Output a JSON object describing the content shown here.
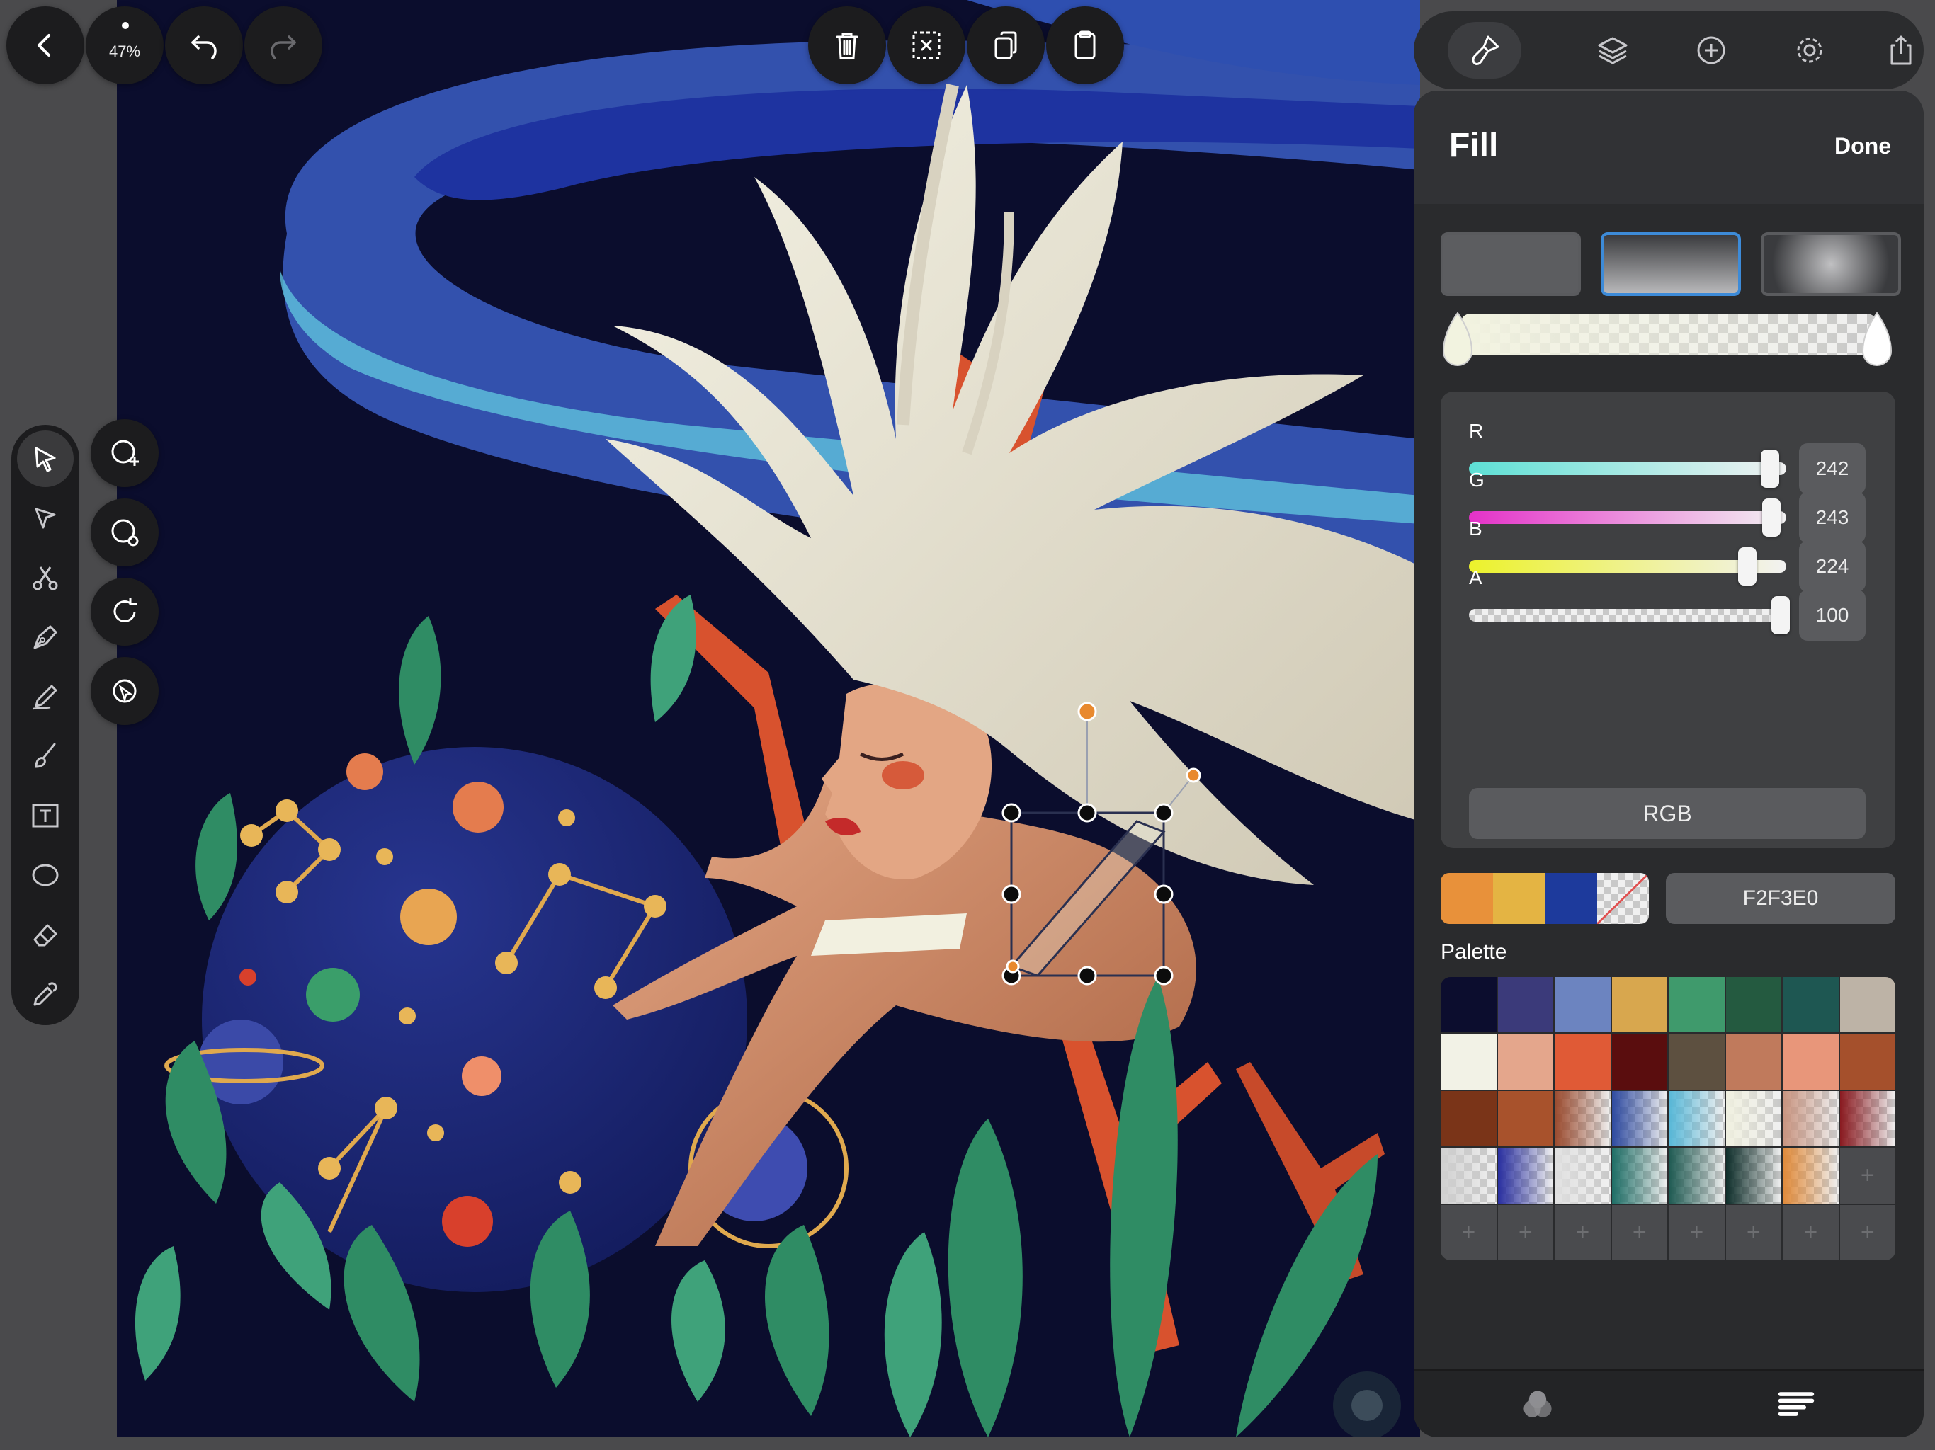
{
  "nav": {
    "zoom_label": "47%"
  },
  "panel": {
    "title": "Fill",
    "done_label": "Done",
    "fill_types": [
      "solid",
      "linear-gradient",
      "radial-gradient"
    ],
    "selected_fill_type": "linear-gradient",
    "channels": [
      {
        "label": "R",
        "value": "242",
        "level": 0.949,
        "track": "linear-gradient(90deg,#5de0d5,#f2f2f2)"
      },
      {
        "label": "G",
        "value": "243",
        "level": 0.953,
        "track": "linear-gradient(90deg,#e431c8,#f2f2f2)"
      },
      {
        "label": "B",
        "value": "224",
        "level": 0.878,
        "track": "linear-gradient(90deg,#ecf22b,#f2f2f2)"
      },
      {
        "label": "A",
        "value": "100",
        "level": 1.0,
        "track": "checker"
      }
    ],
    "mode_label": "RGB",
    "recent_colors": [
      "#e8913a",
      "#e4b443",
      "#1d3a9c",
      "transparent"
    ],
    "hex_value": "F2F3E0",
    "palette_label": "Palette",
    "palette": [
      [
        "#0c0d2e",
        "#3b3a7a",
        "#6c84c0",
        "#d8a74e",
        "#3f9a6c",
        "#245a40",
        "#1e5752",
        "#bdb3a6"
      ],
      [
        "#f2f2e6",
        "#e4a68c",
        "#e05a36",
        "#5a0d0e",
        "#5d5040",
        "#c07a5c",
        "#e8967a",
        "#a5502c"
      ],
      [
        "#7a3418",
        "#a8522c",
        "gradient:#9a4a2e",
        "gradient:#2e4aa0",
        "gradient:#58b8d8",
        "gradient:#f0f0e0",
        "gradient:#c89480",
        "gradient:#8a1a20"
      ],
      [
        "gradient:#d0d0d0",
        "gradient:#2a30a0",
        "gradient:#e0e0e0",
        "gradient:#1e6e66",
        "gradient:#1e5a52",
        "gradient:#0e2e2a",
        "gradient:#e08a3a",
        "+"
      ],
      [
        "+",
        "+",
        "+",
        "+",
        "+",
        "+",
        "+",
        "+"
      ]
    ]
  },
  "icons": {
    "back": "chevron-left-icon",
    "undo": "undo-icon",
    "redo": "redo-icon",
    "delete": "trash-icon",
    "deselect": "deselect-icon",
    "duplicate": "duplicate-icon",
    "paste": "clipboard-icon"
  }
}
